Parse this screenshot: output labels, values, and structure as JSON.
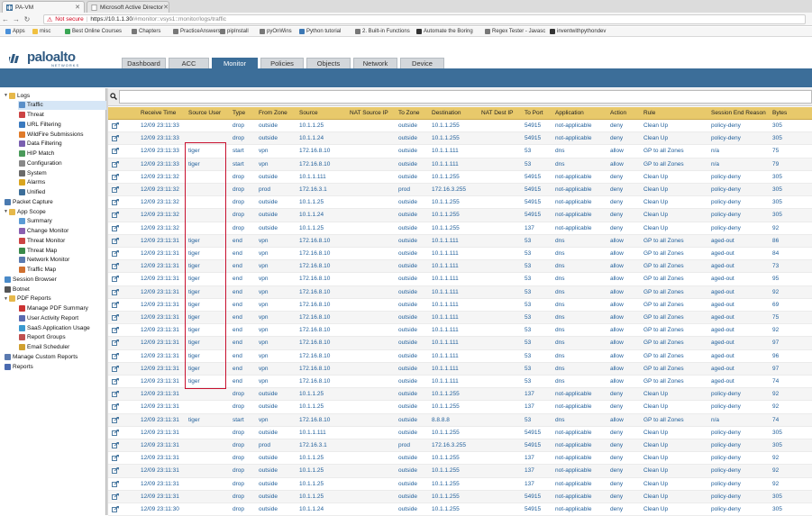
{
  "browser": {
    "tabs": [
      {
        "title": "PA-VM",
        "active": true
      },
      {
        "title": "Microsoft Active Director",
        "active": false
      }
    ],
    "not_secure": "Not secure",
    "url_host": "https://10.1.1.30",
    "url_path": "/#monitor::vsys1::monitor/logs/traffic",
    "bookmarks": [
      "Apps",
      "misc",
      "Best Online Courses",
      "Chapters",
      "PracticeAnswers",
      "pipInstall",
      "pyOnWins",
      "Python tutorial",
      "2. Built-in Functions",
      "Automate the Boring",
      "Regex Tester - Javasc",
      "inventwithpythondev"
    ]
  },
  "app": {
    "logo_text": "paloalto",
    "logo_sub": "NETWORKS",
    "tabs": [
      "Dashboard",
      "ACC",
      "Monitor",
      "Policies",
      "Objects",
      "Network",
      "Device"
    ],
    "active_tab": "Monitor"
  },
  "sidebar": {
    "items": [
      {
        "label": "Logs",
        "level": 0,
        "icon": "folder-icon",
        "expanded": true
      },
      {
        "label": "Traffic",
        "level": 1,
        "icon": "traffic-log-icon",
        "selected": true
      },
      {
        "label": "Threat",
        "level": 1,
        "icon": "threat-log-icon"
      },
      {
        "label": "URL Filtering",
        "level": 1,
        "icon": "url-log-icon"
      },
      {
        "label": "WildFire Submissions",
        "level": 1,
        "icon": "wildfire-log-icon"
      },
      {
        "label": "Data Filtering",
        "level": 1,
        "icon": "data-log-icon"
      },
      {
        "label": "HIP Match",
        "level": 1,
        "icon": "hip-log-icon"
      },
      {
        "label": "Configuration",
        "level": 1,
        "icon": "config-log-icon"
      },
      {
        "label": "System",
        "level": 1,
        "icon": "system-log-icon"
      },
      {
        "label": "Alarms",
        "level": 1,
        "icon": "alarm-log-icon"
      },
      {
        "label": "Unified",
        "level": 1,
        "icon": "unified-log-icon"
      },
      {
        "label": "Packet Capture",
        "level": 0,
        "icon": "packet-capture-icon"
      },
      {
        "label": "App Scope",
        "level": 0,
        "icon": "folder-icon",
        "expanded": true
      },
      {
        "label": "Summary",
        "level": 1,
        "icon": "summary-icon"
      },
      {
        "label": "Change Monitor",
        "level": 1,
        "icon": "change-monitor-icon"
      },
      {
        "label": "Threat Monitor",
        "level": 1,
        "icon": "threat-monitor-icon"
      },
      {
        "label": "Threat Map",
        "level": 1,
        "icon": "threat-map-icon"
      },
      {
        "label": "Network Monitor",
        "level": 1,
        "icon": "network-monitor-icon"
      },
      {
        "label": "Traffic Map",
        "level": 1,
        "icon": "traffic-map-icon"
      },
      {
        "label": "Session Browser",
        "level": 0,
        "icon": "session-browser-icon"
      },
      {
        "label": "Botnet",
        "level": 0,
        "icon": "botnet-icon"
      },
      {
        "label": "PDF Reports",
        "level": 0,
        "icon": "folder-icon",
        "expanded": true
      },
      {
        "label": "Manage PDF Summary",
        "level": 1,
        "icon": "pdf-summary-icon"
      },
      {
        "label": "User Activity Report",
        "level": 1,
        "icon": "user-activity-icon"
      },
      {
        "label": "SaaS Application Usage",
        "level": 1,
        "icon": "saas-icon"
      },
      {
        "label": "Report Groups",
        "level": 1,
        "icon": "report-groups-icon"
      },
      {
        "label": "Email Scheduler",
        "level": 1,
        "icon": "email-scheduler-icon"
      },
      {
        "label": "Manage Custom Reports",
        "level": 0,
        "icon": "custom-reports-icon"
      },
      {
        "label": "Reports",
        "level": 0,
        "icon": "reports-icon"
      }
    ]
  },
  "table": {
    "headers": [
      "Receive Time",
      "Source User",
      "Type",
      "From Zone",
      "Source",
      "NAT Source IP",
      "To Zone",
      "Destination",
      "NAT Dest IP",
      "To Port",
      "Application",
      "Action",
      "Rule",
      "Session End Reason",
      "Bytes"
    ],
    "rows": [
      [
        "12/09 23:11:33",
        "",
        "drop",
        "outside",
        "10.1.1.25",
        "",
        "outside",
        "10.1.1.255",
        "",
        "54915",
        "not-applicable",
        "deny",
        "Clean Up",
        "policy-deny",
        "305"
      ],
      [
        "12/09 23:11:33",
        "",
        "drop",
        "outside",
        "10.1.1.24",
        "",
        "outside",
        "10.1.1.255",
        "",
        "54915",
        "not-applicable",
        "deny",
        "Clean Up",
        "policy-deny",
        "305"
      ],
      [
        "12/09 23:11:33",
        "tiger",
        "start",
        "vpn",
        "172.16.8.10",
        "",
        "outside",
        "10.1.1.111",
        "",
        "53",
        "dns",
        "allow",
        "GP to all Zones",
        "n/a",
        "75"
      ],
      [
        "12/09 23:11:33",
        "tiger",
        "start",
        "vpn",
        "172.16.8.10",
        "",
        "outside",
        "10.1.1.111",
        "",
        "53",
        "dns",
        "allow",
        "GP to all Zones",
        "n/a",
        "79"
      ],
      [
        "12/09 23:11:32",
        "",
        "drop",
        "outside",
        "10.1.1.111",
        "",
        "outside",
        "10.1.1.255",
        "",
        "54915",
        "not-applicable",
        "deny",
        "Clean Up",
        "policy-deny",
        "305"
      ],
      [
        "12/09 23:11:32",
        "",
        "drop",
        "prod",
        "172.16.3.1",
        "",
        "prod",
        "172.16.3.255",
        "",
        "54915",
        "not-applicable",
        "deny",
        "Clean Up",
        "policy-deny",
        "305"
      ],
      [
        "12/09 23:11:32",
        "",
        "drop",
        "outside",
        "10.1.1.25",
        "",
        "outside",
        "10.1.1.255",
        "",
        "54915",
        "not-applicable",
        "deny",
        "Clean Up",
        "policy-deny",
        "305"
      ],
      [
        "12/09 23:11:32",
        "",
        "drop",
        "outside",
        "10.1.1.24",
        "",
        "outside",
        "10.1.1.255",
        "",
        "54915",
        "not-applicable",
        "deny",
        "Clean Up",
        "policy-deny",
        "305"
      ],
      [
        "12/09 23:11:32",
        "",
        "drop",
        "outside",
        "10.1.1.25",
        "",
        "outside",
        "10.1.1.255",
        "",
        "137",
        "not-applicable",
        "deny",
        "Clean Up",
        "policy-deny",
        "92"
      ],
      [
        "12/09 23:11:31",
        "tiger",
        "end",
        "vpn",
        "172.16.8.10",
        "",
        "outside",
        "10.1.1.111",
        "",
        "53",
        "dns",
        "allow",
        "GP to all Zones",
        "aged-out",
        "86"
      ],
      [
        "12/09 23:11:31",
        "tiger",
        "end",
        "vpn",
        "172.16.8.10",
        "",
        "outside",
        "10.1.1.111",
        "",
        "53",
        "dns",
        "allow",
        "GP to all Zones",
        "aged-out",
        "84"
      ],
      [
        "12/09 23:11:31",
        "tiger",
        "end",
        "vpn",
        "172.16.8.10",
        "",
        "outside",
        "10.1.1.111",
        "",
        "53",
        "dns",
        "allow",
        "GP to all Zones",
        "aged-out",
        "73"
      ],
      [
        "12/09 23:11:31",
        "tiger",
        "end",
        "vpn",
        "172.16.8.10",
        "",
        "outside",
        "10.1.1.111",
        "",
        "53",
        "dns",
        "allow",
        "GP to all Zones",
        "aged-out",
        "95"
      ],
      [
        "12/09 23:11:31",
        "tiger",
        "end",
        "vpn",
        "172.16.8.10",
        "",
        "outside",
        "10.1.1.111",
        "",
        "53",
        "dns",
        "allow",
        "GP to all Zones",
        "aged-out",
        "92"
      ],
      [
        "12/09 23:11:31",
        "tiger",
        "end",
        "vpn",
        "172.16.8.10",
        "",
        "outside",
        "10.1.1.111",
        "",
        "53",
        "dns",
        "allow",
        "GP to all Zones",
        "aged-out",
        "69"
      ],
      [
        "12/09 23:11:31",
        "tiger",
        "end",
        "vpn",
        "172.16.8.10",
        "",
        "outside",
        "10.1.1.111",
        "",
        "53",
        "dns",
        "allow",
        "GP to all Zones",
        "aged-out",
        "75"
      ],
      [
        "12/09 23:11:31",
        "tiger",
        "end",
        "vpn",
        "172.16.8.10",
        "",
        "outside",
        "10.1.1.111",
        "",
        "53",
        "dns",
        "allow",
        "GP to all Zones",
        "aged-out",
        "92"
      ],
      [
        "12/09 23:11:31",
        "tiger",
        "end",
        "vpn",
        "172.16.8.10",
        "",
        "outside",
        "10.1.1.111",
        "",
        "53",
        "dns",
        "allow",
        "GP to all Zones",
        "aged-out",
        "97"
      ],
      [
        "12/09 23:11:31",
        "tiger",
        "end",
        "vpn",
        "172.16.8.10",
        "",
        "outside",
        "10.1.1.111",
        "",
        "53",
        "dns",
        "allow",
        "GP to all Zones",
        "aged-out",
        "96"
      ],
      [
        "12/09 23:11:31",
        "tiger",
        "end",
        "vpn",
        "172.16.8.10",
        "",
        "outside",
        "10.1.1.111",
        "",
        "53",
        "dns",
        "allow",
        "GP to all Zones",
        "aged-out",
        "97"
      ],
      [
        "12/09 23:11:31",
        "tiger",
        "end",
        "vpn",
        "172.16.8.10",
        "",
        "outside",
        "10.1.1.111",
        "",
        "53",
        "dns",
        "allow",
        "GP to all Zones",
        "aged-out",
        "74"
      ],
      [
        "12/09 23:11:31",
        "",
        "drop",
        "outside",
        "10.1.1.25",
        "",
        "outside",
        "10.1.1.255",
        "",
        "137",
        "not-applicable",
        "deny",
        "Clean Up",
        "policy-deny",
        "92"
      ],
      [
        "12/09 23:11:31",
        "",
        "drop",
        "outside",
        "10.1.1.25",
        "",
        "outside",
        "10.1.1.255",
        "",
        "137",
        "not-applicable",
        "deny",
        "Clean Up",
        "policy-deny",
        "92"
      ],
      [
        "12/09 23:11:31",
        "tiger",
        "start",
        "vpn",
        "172.16.8.10",
        "",
        "outside",
        "8.8.8.8",
        "",
        "53",
        "dns",
        "allow",
        "GP to all Zones",
        "n/a",
        "74"
      ],
      [
        "12/09 23:11:31",
        "",
        "drop",
        "outside",
        "10.1.1.111",
        "",
        "outside",
        "10.1.1.255",
        "",
        "54915",
        "not-applicable",
        "deny",
        "Clean Up",
        "policy-deny",
        "305"
      ],
      [
        "12/09 23:11:31",
        "",
        "drop",
        "prod",
        "172.16.3.1",
        "",
        "prod",
        "172.16.3.255",
        "",
        "54915",
        "not-applicable",
        "deny",
        "Clean Up",
        "policy-deny",
        "305"
      ],
      [
        "12/09 23:11:31",
        "",
        "drop",
        "outside",
        "10.1.1.25",
        "",
        "outside",
        "10.1.1.255",
        "",
        "137",
        "not-applicable",
        "deny",
        "Clean Up",
        "policy-deny",
        "92"
      ],
      [
        "12/09 23:11:31",
        "",
        "drop",
        "outside",
        "10.1.1.25",
        "",
        "outside",
        "10.1.1.255",
        "",
        "137",
        "not-applicable",
        "deny",
        "Clean Up",
        "policy-deny",
        "92"
      ],
      [
        "12/09 23:11:31",
        "",
        "drop",
        "outside",
        "10.1.1.25",
        "",
        "outside",
        "10.1.1.255",
        "",
        "137",
        "not-applicable",
        "deny",
        "Clean Up",
        "policy-deny",
        "92"
      ],
      [
        "12/09 23:11:31",
        "",
        "drop",
        "outside",
        "10.1.1.25",
        "",
        "outside",
        "10.1.1.255",
        "",
        "54915",
        "not-applicable",
        "deny",
        "Clean Up",
        "policy-deny",
        "305"
      ],
      [
        "12/09 23:11:30",
        "",
        "drop",
        "outside",
        "10.1.1.24",
        "",
        "outside",
        "10.1.1.255",
        "",
        "54915",
        "not-applicable",
        "deny",
        "Clean Up",
        "policy-deny",
        "305"
      ]
    ]
  },
  "colors": {
    "accent": "#3c6e99",
    "header_row": "#e8c96b",
    "link_text": "#1f5e9a",
    "highlight_box": "#c8102e"
  }
}
